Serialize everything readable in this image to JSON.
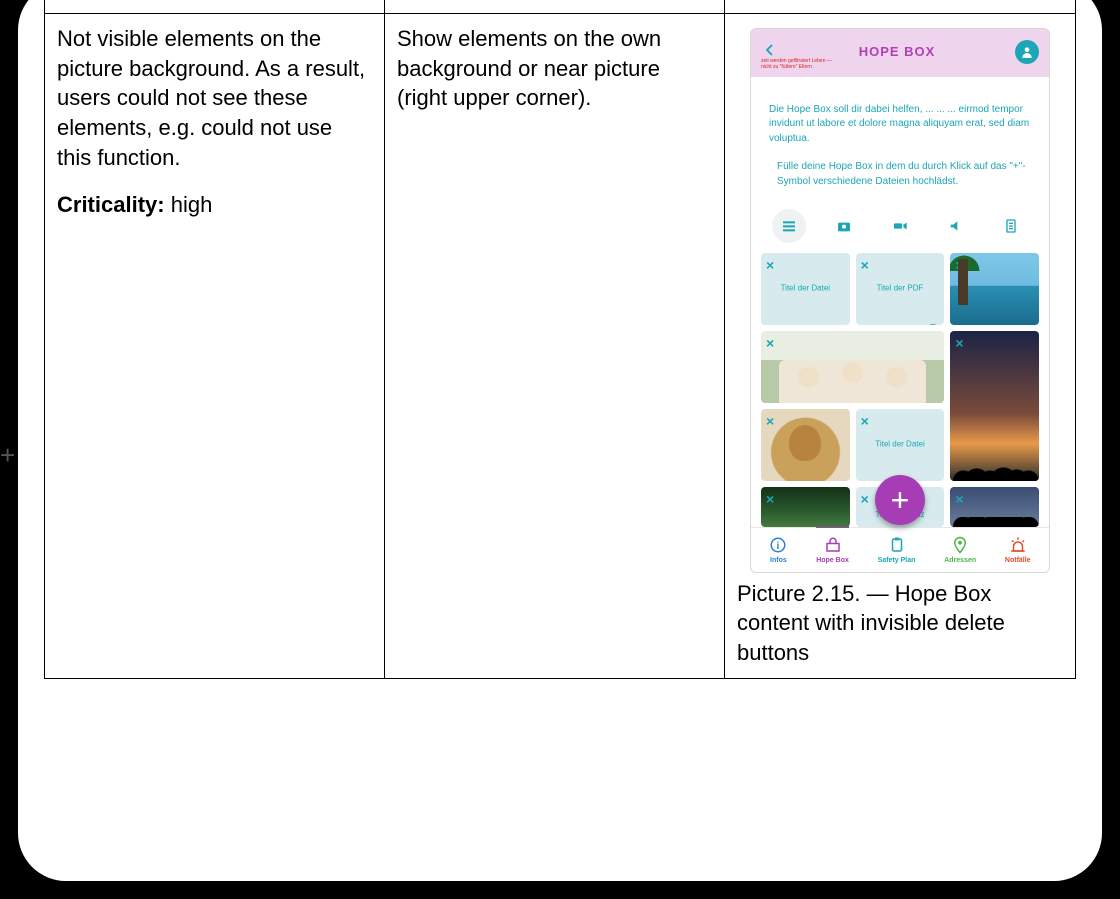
{
  "table": {
    "col1": {
      "problem": "Not visible elements on the picture background. As a result, users could not see these elements, e.g. could not use this function.",
      "crit_label": "Criticality:",
      "crit_value": "high"
    },
    "col2": {
      "solution": "Show elements on the own background or near picture (right upper corner)."
    },
    "col3": {
      "caption": "Picture 2.15. — Hope Box content with invisible delete buttons"
    }
  },
  "edge_plus": "+",
  "phone": {
    "header_title": "HOPE BOX",
    "sublabel": "zeit werden gefiltratert Leben — nicht zu \"füttern\" Eltern",
    "intro": "Die Hope Box soll dir dabei helfen, ... ... ... eirmod tempor invidunt ut labore et dolore magna aliquyam erat, sed diam voluptua.",
    "hint": "Fülle deine Hope Box in dem du durch Klick auf das \"+\"-Symbol verschiedene Dateien hochlädst.",
    "filter_icons": [
      "list-icon",
      "camera-icon",
      "video-icon",
      "sound-icon",
      "file-icon"
    ],
    "tiles": {
      "t1_label": "Titel der Datei",
      "t2_label": "Titel der PDF",
      "t7_label": "Titel der Datei",
      "t10_label": "Titel der Notiz"
    },
    "fab": "+",
    "nav": {
      "infos": "Infos",
      "hopebox": "Hope Box",
      "safety": "Safety Plan",
      "adressen": "Adressen",
      "notfalle": "Notfälle"
    }
  }
}
